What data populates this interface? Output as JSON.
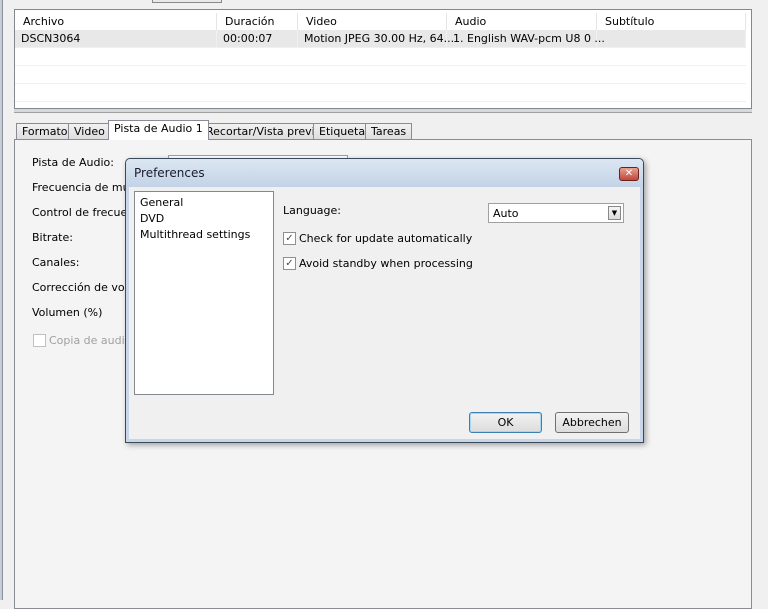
{
  "file_table": {
    "columns": [
      "Archivo",
      "Duración",
      "Video",
      "Audio",
      "Subtítulo"
    ],
    "rows": [
      {
        "archivo": "DSCN3064",
        "duracion": "00:00:07",
        "video": "Motion JPEG 30.00 Hz, 64...",
        "audio": "1. English WAV-pcm U8 0 ...",
        "subtitulo": ""
      }
    ]
  },
  "tabs": [
    "Formato",
    "Video",
    "Pista de Audio 1",
    "Recortar/Vista previa",
    "Etiqueta",
    "Tareas"
  ],
  "audio_panel": {
    "labels": [
      "Pista de Audio:",
      "Frecuencia de mues",
      "Control de frecuenc",
      "Bitrate:",
      "Canales:",
      "Corrección de volun",
      "Volumen (%)"
    ],
    "copia_label": "Copia de audio"
  },
  "dialog": {
    "title": "Preferences",
    "categories": [
      "General",
      "DVD",
      "Multithread settings"
    ],
    "language_label": "Language:",
    "language_value": "Auto",
    "check_update_label": "Check for update automatically",
    "check_update_checked": true,
    "avoid_standby_label": "Avoid standby when processing",
    "avoid_standby_checked": true,
    "ok_label": "OK",
    "cancel_label": "Abbrechen"
  }
}
